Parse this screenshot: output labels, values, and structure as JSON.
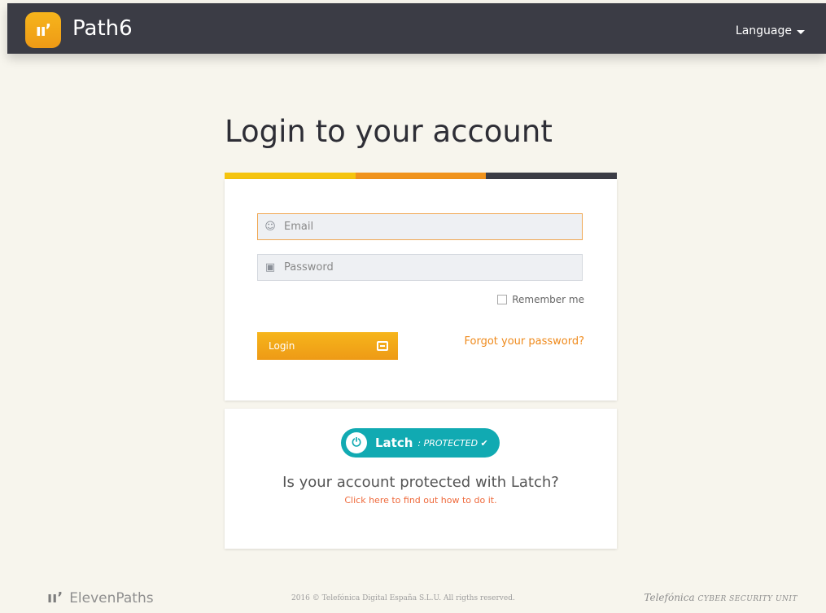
{
  "header": {
    "logo_text": "ıı’",
    "brand": "Path6",
    "language_label": "Language"
  },
  "page": {
    "title": "Login to your account"
  },
  "form": {
    "email_placeholder": "Email",
    "password_placeholder": "Password",
    "remember_label": "Remember me",
    "login_label": "Login",
    "forgot_label": "Forgot your password?"
  },
  "latch": {
    "badge_name": "Latch",
    "badge_status": ": PROTECTED ✔",
    "question": "Is your account protected with Latch?",
    "link": "Click here to find out how to do it."
  },
  "footer": {
    "left_mark": "ıı’",
    "left_text": "ElevenPaths",
    "copyright": "2016 © Telefónica Digital España S.L.U. All rigths reserved.",
    "right_brand": "Telefónica",
    "right_unit": "CYBER SECURITY UNIT"
  },
  "colors": {
    "navbar": "#3b3c45",
    "accent_orange": "#f0a752",
    "latch_teal": "#11aab2",
    "bar_yellow": "#f5c40f",
    "bar_orange": "#f0931c",
    "bar_dark": "#3b3c45"
  }
}
